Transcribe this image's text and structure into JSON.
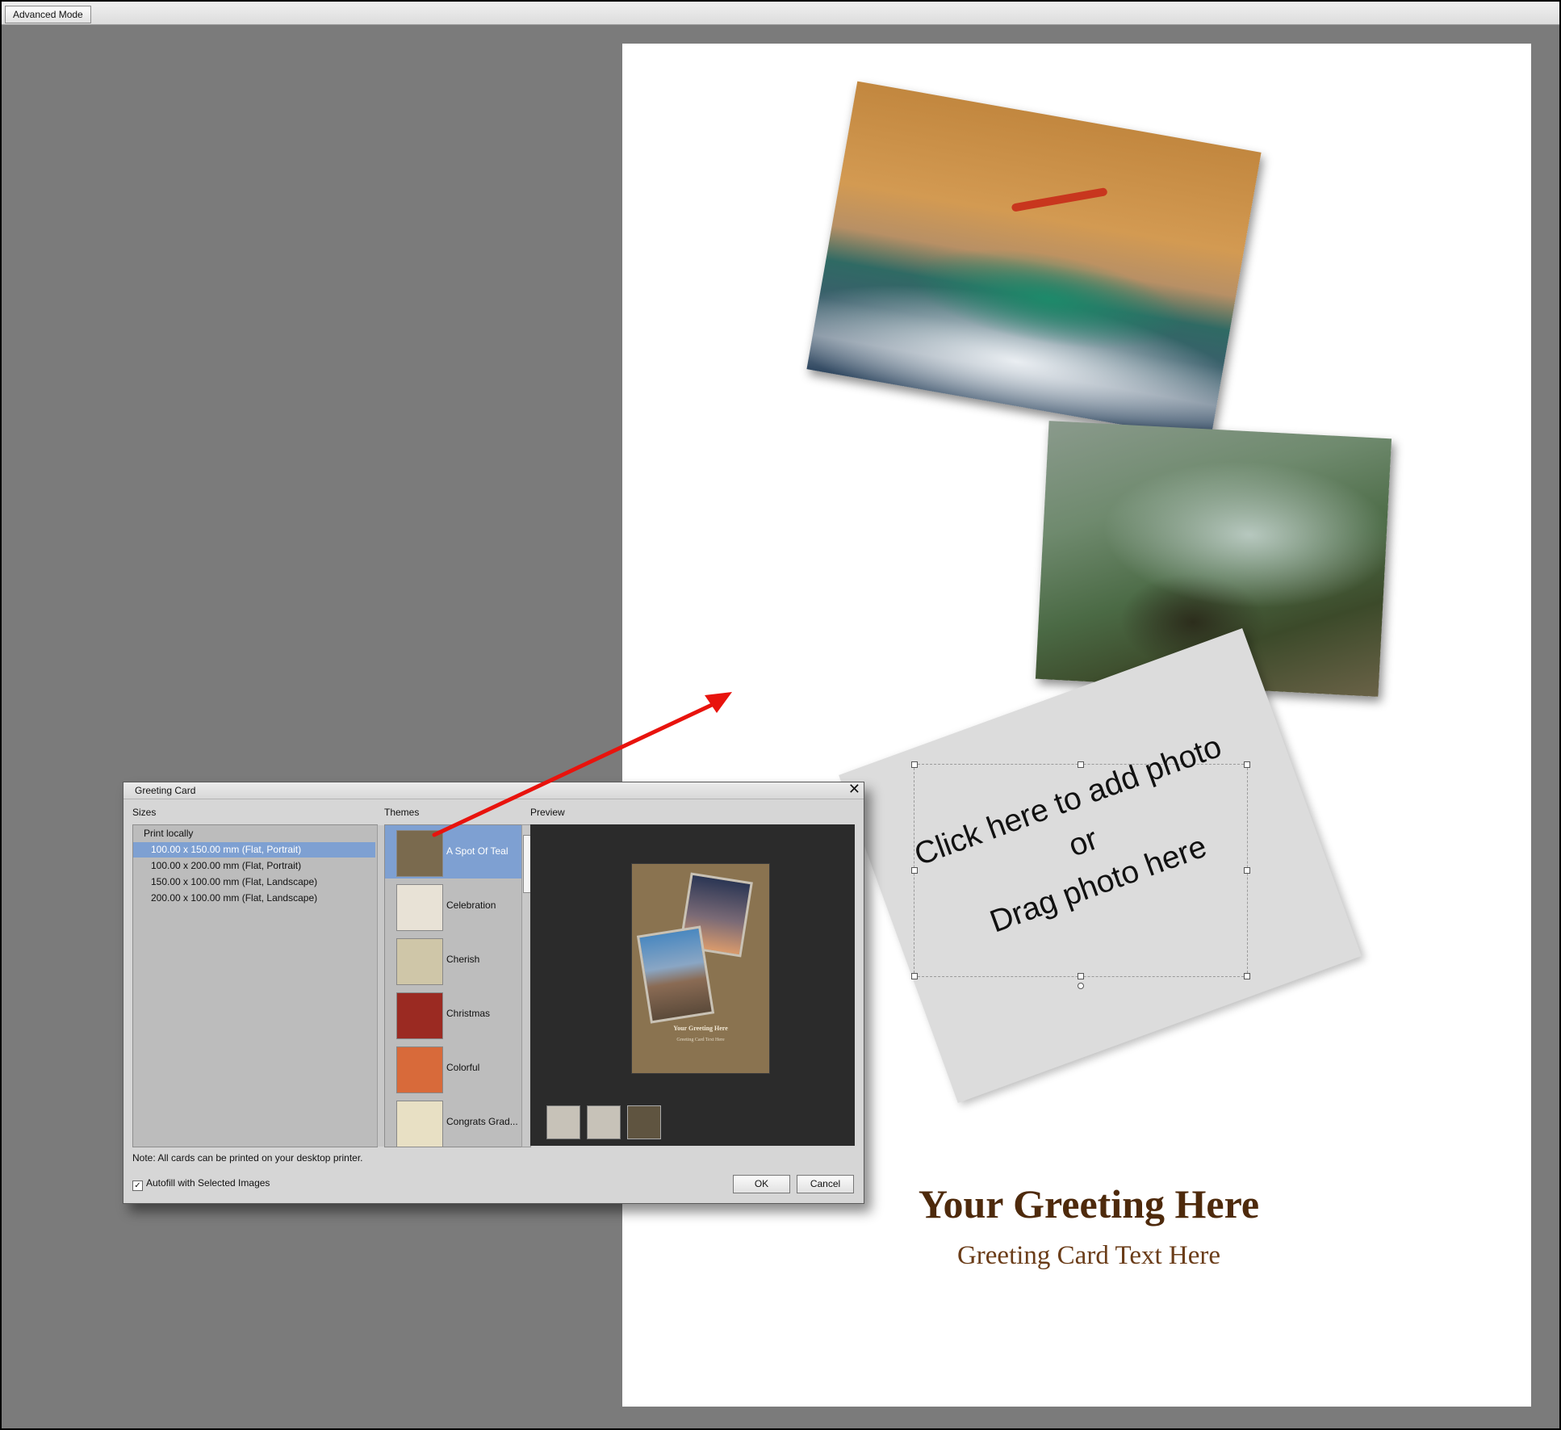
{
  "toolbar": {
    "mode_button": "Advanced Mode"
  },
  "canvas": {
    "drop_zone": {
      "line1": "Click here to add photo",
      "line2": "or",
      "line3": "Drag photo here"
    },
    "greeting_title": "Your Greeting Here",
    "greeting_text": "Greeting Card Text Here"
  },
  "dialog": {
    "title": "Greeting Card",
    "sizes_label": "Sizes",
    "themes_label": "Themes",
    "preview_label": "Preview",
    "sizes_group": "Print locally",
    "sizes": [
      {
        "label": "100.00 x 150.00 mm (Flat, Portrait)",
        "selected": true
      },
      {
        "label": "100.00 x 200.00 mm (Flat, Portrait)",
        "selected": false
      },
      {
        "label": "150.00 x 100.00 mm (Flat, Landscape)",
        "selected": false
      },
      {
        "label": "200.00 x 100.00 mm (Flat, Landscape)",
        "selected": false
      }
    ],
    "themes": [
      {
        "label": "A Spot Of Teal",
        "selected": true,
        "thumb_color": "#7a6a4e"
      },
      {
        "label": "Celebration",
        "selected": false,
        "thumb_color": "#e8e2d6"
      },
      {
        "label": "Cherish",
        "selected": false,
        "thumb_color": "#cfc6a8"
      },
      {
        "label": "Christmas",
        "selected": false,
        "thumb_color": "#9b2a22"
      },
      {
        "label": "Colorful",
        "selected": false,
        "thumb_color": "#d86a3a"
      },
      {
        "label": "Congrats Grad...",
        "selected": false,
        "thumb_color": "#e8e0c4"
      }
    ],
    "preview": {
      "caption_title": "Your Greeting Here",
      "caption_text": "Greeting Card Text Here"
    },
    "note": "Note: All cards can be printed on your desktop printer.",
    "autofill_label": "Autofill with Selected Images",
    "autofill_checked": true,
    "ok_label": "OK",
    "cancel_label": "Cancel"
  },
  "colors": {
    "accent_selection": "#7ea0d2",
    "arrow": "#e8130d",
    "greeting": "#4e2a0c"
  }
}
